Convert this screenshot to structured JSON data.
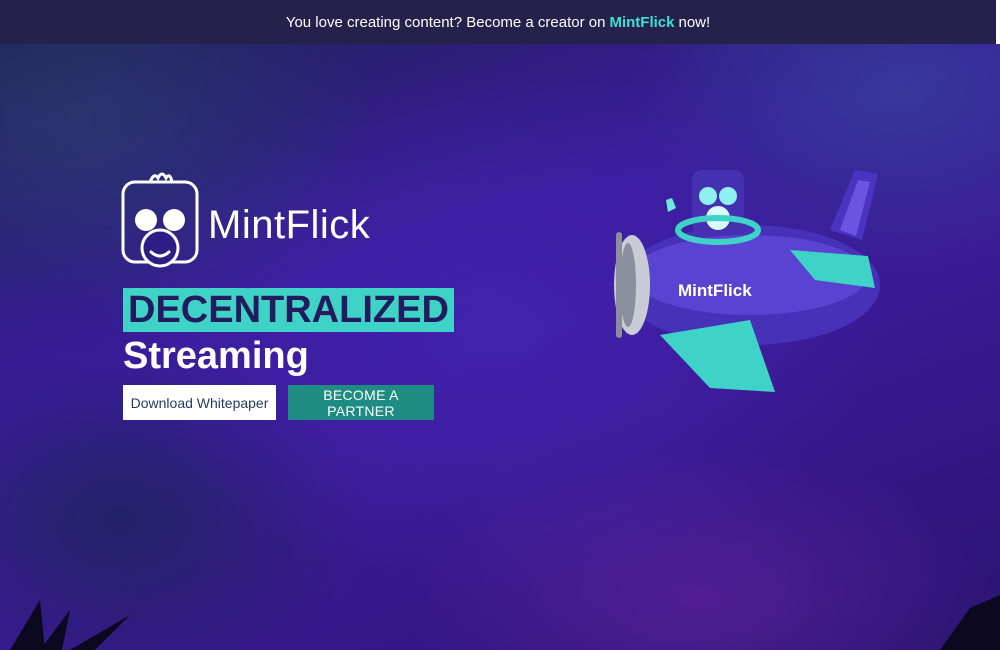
{
  "topbar": {
    "text_before": "You love creating content? Become a creator on",
    "brand": "MintFlick",
    "text_after": "now!"
  },
  "hero": {
    "logo_text": "MintFlick",
    "headline_highlight": "DECENTRALIZED",
    "headline_second": "Streaming",
    "buttons": {
      "download": "Download Whitepaper",
      "partner": "BECOME A PARTNER"
    },
    "plane_label": "MintFlick"
  },
  "colors": {
    "accent": "#3fd3c8",
    "brand_text": "#3fe0d0",
    "partner_button": "#1f8c84",
    "topbar": "#24224a"
  },
  "icons": {
    "logo": "monkey-logo-icon",
    "illustration": "plane-illustration",
    "decor_left": "palm-leaves-left",
    "decor_right": "palm-leaves-right"
  }
}
